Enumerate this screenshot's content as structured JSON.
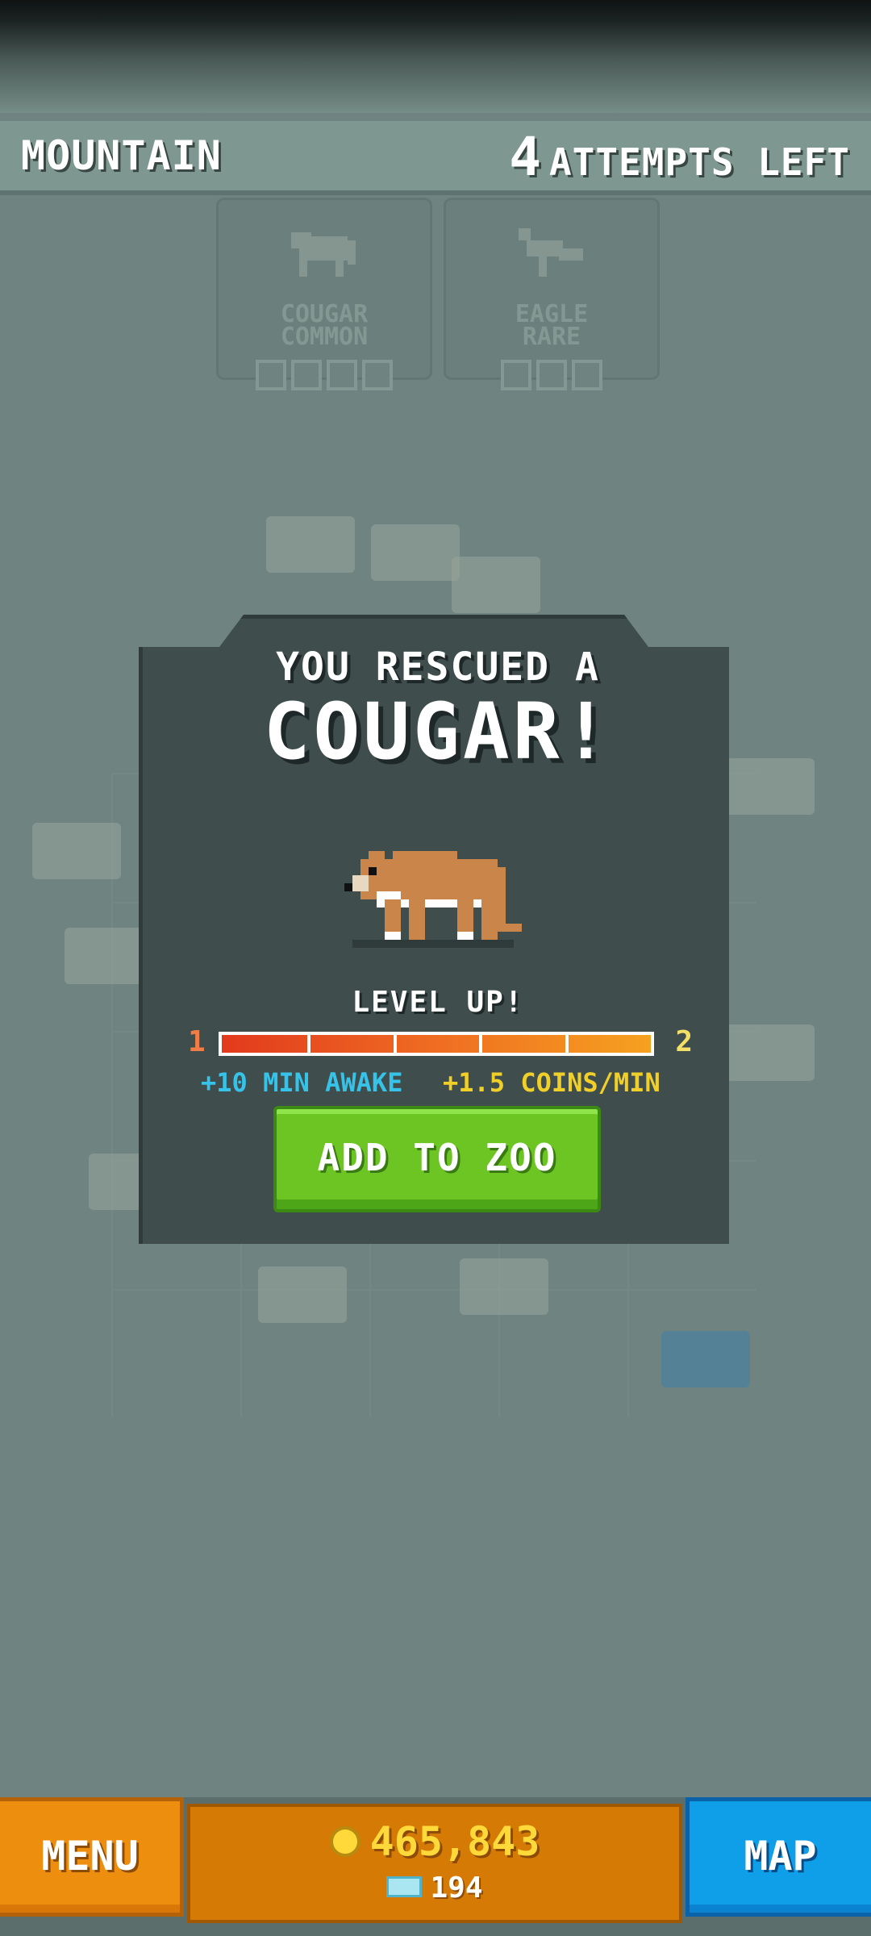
{
  "header": {
    "zone_name": "MOUNTAIN",
    "attempts_number": "4",
    "attempts_label": "ATTEMPTS LEFT"
  },
  "collection_cards": [
    {
      "name_line1": "COUGAR",
      "name_line2": "COMMON",
      "slots": 4,
      "animal": "cougar-icon"
    },
    {
      "name_line1": "EAGLE",
      "name_line2": "RARE",
      "slots": 3,
      "animal": "eagle-icon"
    }
  ],
  "modal": {
    "title_small": "YOU RESCUED A",
    "title_big": "COUGAR!",
    "animal": "cougar-icon",
    "level_up_text": "LEVEL UP!",
    "level_from": "1",
    "level_to": "2",
    "level_progress": 1.0,
    "bonus_awake": "+10 MIN AWAKE",
    "bonus_coins": "+1.5 COINS/MIN",
    "button_label": "ADD TO ZOO"
  },
  "bottom_bar": {
    "menu_label": "MENU",
    "coins": "465,843",
    "gems": "194",
    "map_label": "MAP"
  },
  "colors": {
    "background": "#6f8480",
    "modal": "#3f4d4d",
    "green_button": "#6cc522",
    "menu_orange": "#ee8e0f",
    "map_blue": "#0f9ee8",
    "coin_yellow": "#ffd83a",
    "awake_blue": "#37c2e8"
  }
}
